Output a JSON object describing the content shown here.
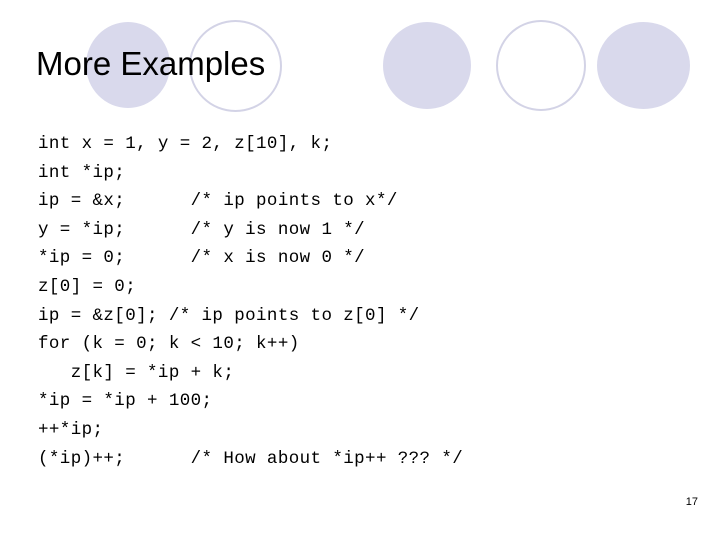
{
  "slide": {
    "title": "More Examples",
    "page_number": "17"
  },
  "decor": {
    "fill_color": "#d9d9ec",
    "outline_color": "#d3d3e6",
    "circles": [
      {
        "name": "decor-circle-1",
        "style": "filled"
      },
      {
        "name": "decor-circle-2",
        "style": "outlined"
      },
      {
        "name": "decor-circle-3",
        "style": "filled"
      },
      {
        "name": "decor-circle-4",
        "style": "outlined"
      },
      {
        "name": "decor-circle-5",
        "style": "filled"
      }
    ]
  },
  "code": {
    "language": "c",
    "lines": [
      "int x = 1, y = 2, z[10], k;",
      "int *ip;",
      "ip = &x;      /* ip points to x*/",
      "y = *ip;      /* y is now 1 */",
      "*ip = 0;      /* x is now 0 */",
      "z[0] = 0;",
      "ip = &z[0]; /* ip points to z[0] */",
      "for (k = 0; k < 10; k++)",
      "   z[k] = *ip + k;",
      "*ip = *ip + 100;",
      "++*ip;",
      "(*ip)++;      /* How about *ip++ ??? */"
    ]
  }
}
